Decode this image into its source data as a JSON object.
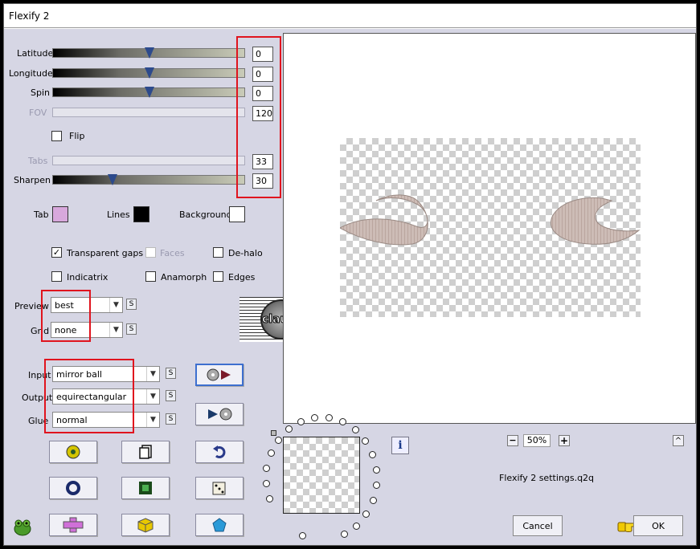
{
  "window": {
    "title": "Flexify 2"
  },
  "sliders": [
    {
      "label": "Latitude",
      "value": "0",
      "enabled": true,
      "thumb": 0.5
    },
    {
      "label": "Longitude",
      "value": "0",
      "enabled": true,
      "thumb": 0.5
    },
    {
      "label": "Spin",
      "value": "0",
      "enabled": true,
      "thumb": 0.5
    },
    {
      "label": "FOV",
      "value": "120",
      "enabled": false
    },
    {
      "label": "Tabs",
      "value": "33",
      "enabled": false
    },
    {
      "label": "Sharpen",
      "value": "30",
      "enabled": true,
      "thumb": 0.3
    }
  ],
  "flip": {
    "label": "Flip",
    "checked": false
  },
  "colors": {
    "tab_label": "Tab",
    "tab_color": "#d8a8dc",
    "lines_label": "Lines",
    "lines_color": "#000000",
    "background_label": "Background",
    "background_color": "#ffffff"
  },
  "options": {
    "transparent_gaps": {
      "label": "Transparent gaps",
      "checked": true
    },
    "faces": {
      "label": "Faces",
      "checked": false
    },
    "de_halo": {
      "label": "De-halo",
      "checked": false
    },
    "indicatrix": {
      "label": "Indicatrix",
      "checked": false
    },
    "anamorph": {
      "label": "Anamorph",
      "checked": false
    },
    "edges": {
      "label": "Edges",
      "checked": false
    }
  },
  "preview_select": {
    "label": "Preview",
    "value": "best"
  },
  "grid_select": {
    "label": "Grid",
    "value": "none"
  },
  "input_select": {
    "label": "Input",
    "value": "mirror ball"
  },
  "output_select": {
    "label": "Output",
    "value": "equirectangular"
  },
  "glue_select": {
    "label": "Glue",
    "value": "normal"
  },
  "s_label": "S",
  "watermark_text": "claudia",
  "zoom": {
    "minus": "−",
    "value": "50%",
    "plus": "+"
  },
  "settings_file": "Flexify 2 settings.q2q",
  "buttons": {
    "cancel": "Cancel",
    "ok": "OK",
    "info": "i",
    "collapse": "^"
  },
  "accent_red": "#e0141e"
}
